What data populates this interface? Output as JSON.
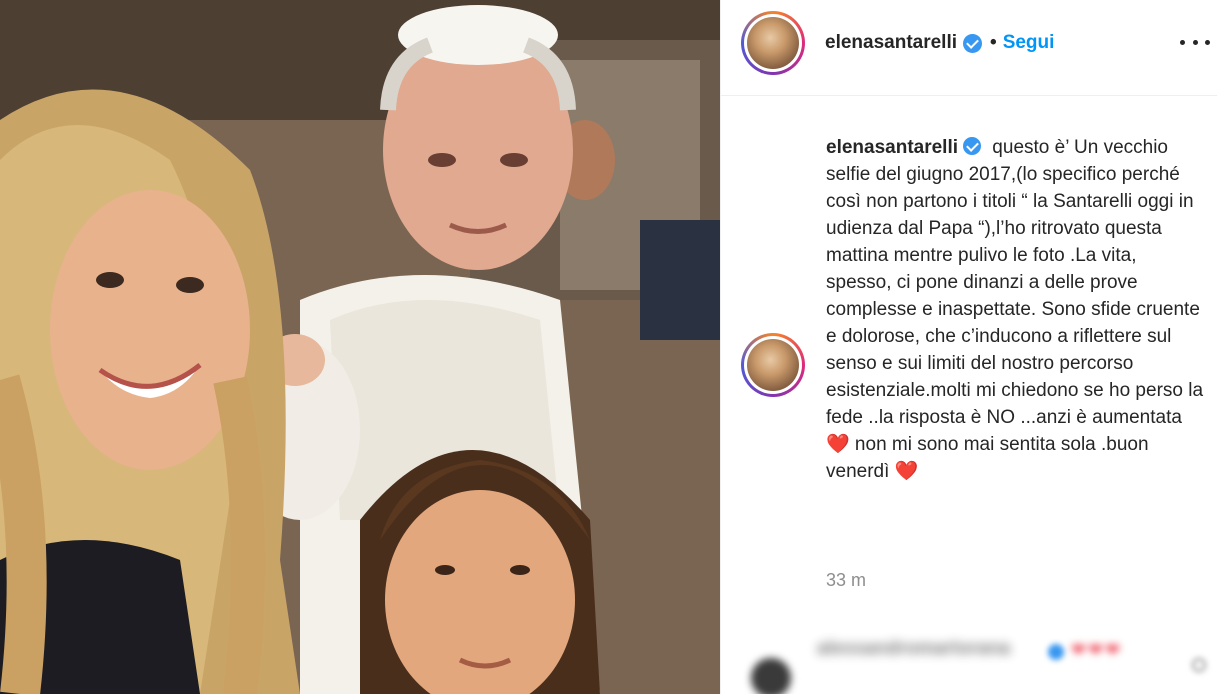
{
  "post": {
    "username": "elenasantarelli",
    "follow_label": "Segui",
    "separator": "•",
    "caption_text": " questo è’ Un vecchio selfie del giugno 2017,(lo specifico perché così non partono i titoli “ la Santarelli oggi in udienza dal Papa “),l’ho ritrovato questa mattina mentre pulivo le foto .La vita, spesso, ci pone dinanzi a delle prove complesse e inaspettate. Sono sfide cruente e dolorose, che c’inducono a riflettere sul senso e sui limiti del nostro percorso esistenziale.molti mi chiedono se ho perso la fede ..la risposta è NO ...anzi è aumentata ❤️ non mi sono mai sentita sola .buon venerdì ❤️",
    "timestamp": "33 m"
  },
  "comment": {
    "username_blurred": "alessandromartorana",
    "text_blurred": "❤❤❤"
  },
  "icons": {
    "verified": "verified-badge-icon",
    "more": "more-options-icon"
  },
  "colors": {
    "accent_blue": "#0095f6",
    "verified_blue": "#3897f0",
    "text": "#262626",
    "muted": "#8e8e8e"
  }
}
